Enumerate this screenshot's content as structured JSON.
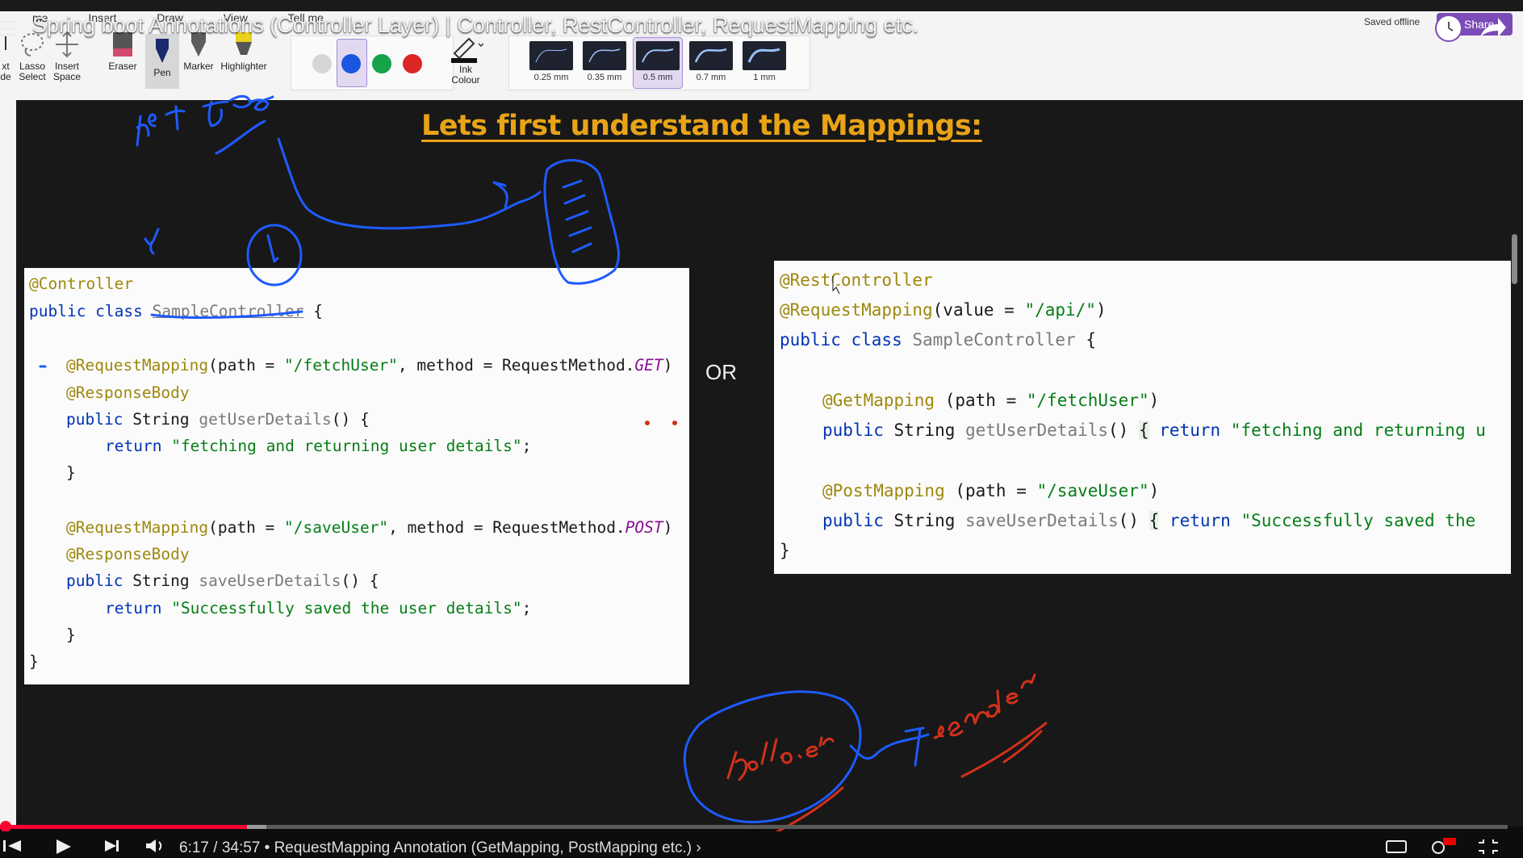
{
  "video": {
    "title": "Spring boot Annotations (Controller Layer) | Controller, RestController, RequestMapping etc.",
    "time": "6:17 / 34:57 • RequestMapping Annotation (GetMapping, PostMapping etc.) ›",
    "progress_fraction": 0.18
  },
  "ribbon": {
    "menu": [
      "me",
      "Insert",
      "Draw",
      "View",
      "Tell me"
    ],
    "tools": {
      "text_mode": "xt\nde",
      "lasso": "Lasso\nSelect",
      "insert_space": "Insert\nSpace",
      "eraser": "Eraser",
      "pen": "Pen",
      "marker": "Marker",
      "highlighter": "Highlighter",
      "ink_colour": "Ink\nColour"
    },
    "colors": [
      "#d6d6d6",
      "#1a56e0",
      "#16a34a",
      "#dc2626"
    ],
    "selected_color": "#1a56e0",
    "widths": [
      "0.25 mm",
      "0.35 mm",
      "0.5 mm",
      "0.7 mm",
      "1 mm"
    ],
    "selected_width": "0.5 mm",
    "saved_status": "Saved offline",
    "share_label": "Share"
  },
  "slide": {
    "title": "Lets first understand the Mappings:",
    "or_label": "OR",
    "left_code": [
      "@Controller",
      "public class SampleController {",
      "@RequestMapping(path = \"/fetchUser\", method = RequestMethod.GET)",
      "@ResponseBody",
      "public String getUserDetails() {",
      "return \"fetching and returning user details\";",
      "}",
      "@RequestMapping(path = \"/saveUser\", method = RequestMethod.POST)",
      "@ResponseBody",
      "public String saveUserDetails() {",
      "return \"Successfully saved the user details\";",
      "}",
      "}"
    ],
    "right_code": [
      "@RestController",
      "@RequestMapping(value = \"/api/\")",
      "public class SampleController {",
      "@GetMapping (path = \"/fetchUser\")",
      "public String getUserDetails() { return \"fetching and returning u",
      "@PostMapping (path = \"/saveUser\")",
      "public String saveUserDetails() { return \"Successfully saved the",
      "}"
    ]
  }
}
